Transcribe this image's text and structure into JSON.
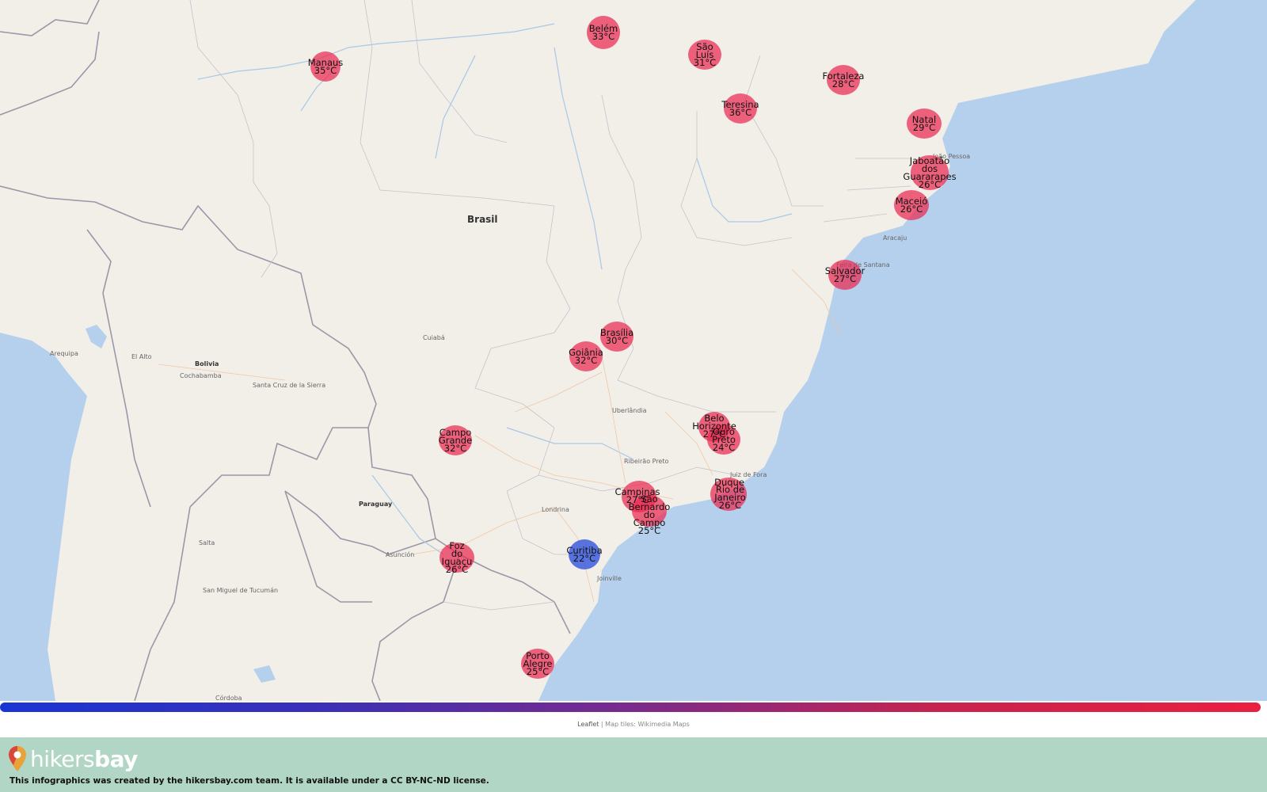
{
  "map": {
    "country_labels": [
      {
        "id": "brasil",
        "text": "Brasil"
      },
      {
        "id": "bolivia",
        "text": "Bolivia"
      },
      {
        "id": "paraguay",
        "text": "Paraguay"
      }
    ],
    "place_labels": [
      {
        "id": "arequipa",
        "text": "Arequipa"
      },
      {
        "id": "el-alto",
        "text": "El Alto"
      },
      {
        "id": "cochabamba",
        "text": "Cochabamba"
      },
      {
        "id": "santa-cruz",
        "text": "Santa Cruz de la Sierra"
      },
      {
        "id": "cuiaba",
        "text": "Cuiabá"
      },
      {
        "id": "uberlandia",
        "text": "Uberlândia"
      },
      {
        "id": "ribeirao",
        "text": "Ribeirão Preto"
      },
      {
        "id": "juiz-de-fora",
        "text": "Juiz de Fora"
      },
      {
        "id": "londrina",
        "text": "Londrina"
      },
      {
        "id": "asuncion",
        "text": "Asunción"
      },
      {
        "id": "salta",
        "text": "Salta"
      },
      {
        "id": "tucuman",
        "text": "San Miguel de Tucumán"
      },
      {
        "id": "joinville",
        "text": "Joinville"
      },
      {
        "id": "aracaju",
        "text": "Aracaju"
      },
      {
        "id": "feira",
        "text": "Feira de Santana"
      },
      {
        "id": "joao-pessoa",
        "text": "João Pessoa"
      },
      {
        "id": "cordoba",
        "text": "Córdoba"
      }
    ],
    "cities": [
      {
        "id": "manaus",
        "name_lines": [
          "Manaus"
        ],
        "temp": "35°C",
        "kind": "warm"
      },
      {
        "id": "belem",
        "name_lines": [
          "Belém"
        ],
        "temp": "33°C",
        "kind": "warm"
      },
      {
        "id": "sao-luis",
        "name_lines": [
          "São",
          "Luís"
        ],
        "temp": "31°C",
        "kind": "warm"
      },
      {
        "id": "fortaleza",
        "name_lines": [
          "Fortaleza"
        ],
        "temp": "28°C",
        "kind": "warm"
      },
      {
        "id": "teresina",
        "name_lines": [
          "Teresina"
        ],
        "temp": "36°C",
        "kind": "warm"
      },
      {
        "id": "natal",
        "name_lines": [
          "Natal"
        ],
        "temp": "29°C",
        "kind": "warm"
      },
      {
        "id": "jaboatao",
        "name_lines": [
          "Jaboatão",
          "dos",
          "Guararapes"
        ],
        "temp": "26°C",
        "kind": "warm"
      },
      {
        "id": "maceio",
        "name_lines": [
          "Maceió"
        ],
        "temp": "26°C",
        "kind": "warm"
      },
      {
        "id": "salvador",
        "name_lines": [
          "Salvador"
        ],
        "temp": "27°C",
        "kind": "warm"
      },
      {
        "id": "brasilia",
        "name_lines": [
          "Brasília"
        ],
        "temp": "30°C",
        "kind": "warm"
      },
      {
        "id": "goiania",
        "name_lines": [
          "Goiânia"
        ],
        "temp": "32°C",
        "kind": "warm"
      },
      {
        "id": "campo-grande",
        "name_lines": [
          "Campo",
          "Grande"
        ],
        "temp": "32°C",
        "kind": "warm"
      },
      {
        "id": "belo-horizonte",
        "name_lines": [
          "Belo",
          "Horizonte"
        ],
        "temp": "27°C",
        "kind": "warm"
      },
      {
        "id": "ouro-preto",
        "name_lines": [
          "Ouro",
          "Preto"
        ],
        "temp": "24°C",
        "kind": "warm"
      },
      {
        "id": "duque-de-caxias",
        "name_lines": [
          "Duque"
        ],
        "temp": "",
        "kind": "warm"
      },
      {
        "id": "rio",
        "name_lines": [
          "Rio de",
          "Janeiro"
        ],
        "temp": "26°C",
        "kind": "warm"
      },
      {
        "id": "campinas",
        "name_lines": [
          "Campinas"
        ],
        "temp": "27°C",
        "kind": "warm"
      },
      {
        "id": "sbc",
        "name_lines": [
          "São",
          "Bernardo",
          "do",
          "Campo"
        ],
        "temp": "25°C",
        "kind": "warm"
      },
      {
        "id": "curitiba",
        "name_lines": [
          "Curitiba"
        ],
        "temp": "22°C",
        "kind": "cool"
      },
      {
        "id": "foz",
        "name_lines": [
          "Foz",
          "do",
          "Iguaçu"
        ],
        "temp": "26°C",
        "kind": "warm"
      },
      {
        "id": "porto-alegre",
        "name_lines": [
          "Porto",
          "Alegre"
        ],
        "temp": "25°C",
        "kind": "warm"
      }
    ]
  },
  "scale": {
    "colors": [
      "#1a34d4",
      "#7a2a8c",
      "#ea2040"
    ]
  },
  "attribution": {
    "leaflet": "Leaflet",
    "separator": " | Map tiles: ",
    "tiles": "Wikimedia Maps"
  },
  "footer": {
    "logo_light": "hikers",
    "logo_bold": "bay",
    "license": "This infographics was created by the hikersbay.com team. It is available under a CC BY-NC-ND license."
  }
}
